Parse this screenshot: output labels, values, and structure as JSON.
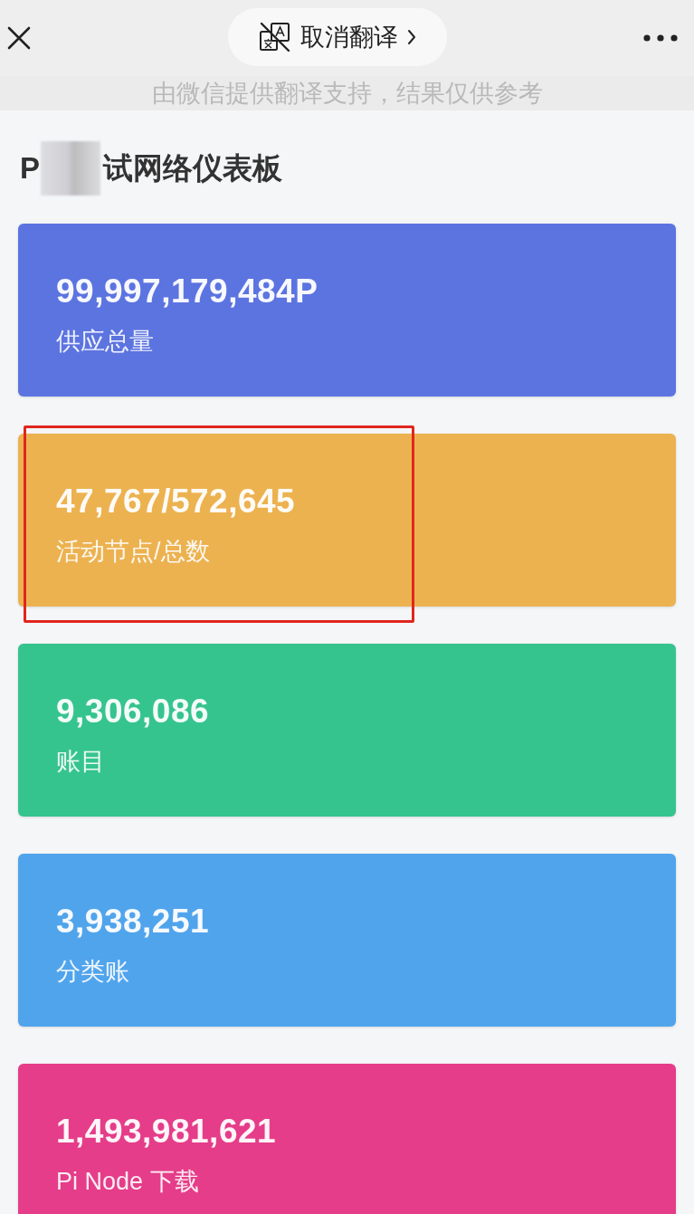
{
  "top_bar": {
    "translate_button": {
      "label": "取消翻译"
    }
  },
  "translation_notice": "由微信提供翻译支持，结果仅供参考",
  "page_title": {
    "before_redaction": "P",
    "after_redaction": "试网络仪表板"
  },
  "cards": [
    {
      "value": "99,997,179,484P",
      "label": "供应总量",
      "color": "#5c74e0",
      "highlighted": false
    },
    {
      "value": "47,767/572,645",
      "label": "活动节点/总数",
      "color": "#ecb250",
      "highlighted": true
    },
    {
      "value": "9,306,086",
      "label": "账目",
      "color": "#36c48e",
      "highlighted": false
    },
    {
      "value": "3,938,251",
      "label": "分类账",
      "color": "#50a4ec",
      "highlighted": false
    },
    {
      "value": "1,493,981,621",
      "label": "Pi Node 下载",
      "color": "#e53d89",
      "highlighted": false
    }
  ]
}
